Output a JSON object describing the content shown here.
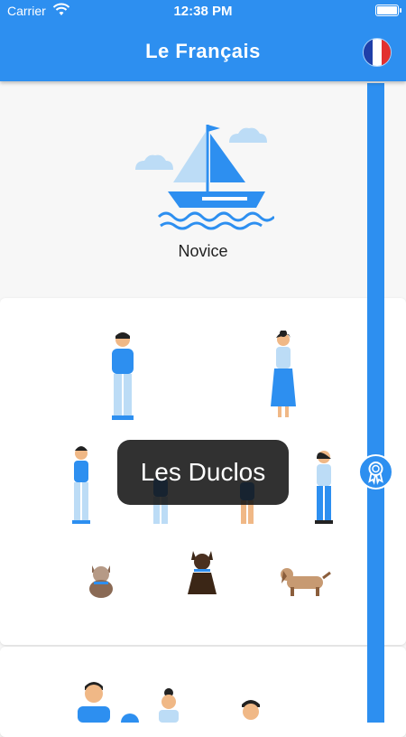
{
  "status_bar": {
    "carrier": "Carrier",
    "time": "12:38 PM"
  },
  "header": {
    "title": "Le Français"
  },
  "level": {
    "label": "Novice"
  },
  "lesson": {
    "title": "Les Duclos"
  },
  "colors": {
    "accent": "#2d8ff0",
    "flag_blue": "#1f3fa8",
    "flag_red": "#e2302f"
  },
  "icons": [
    "wifi-icon",
    "battery-icon",
    "french-flag-icon",
    "sailboat-icon",
    "ribbon-badge-icon"
  ]
}
